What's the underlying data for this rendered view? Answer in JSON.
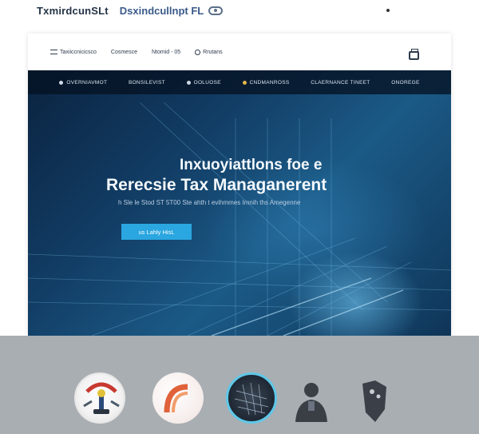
{
  "topbar": {
    "brand_primary": "TxmirdcunSLt",
    "brand_secondary": "Dsxindcullnpt FL"
  },
  "subnav": {
    "items": [
      "Taxiiccnicicsco",
      "Cosmesce",
      "Ntomid - 05",
      "Rrutans"
    ]
  },
  "hero": {
    "nav": [
      "OVERNIAVMOT",
      "BONSILEVIST",
      "OOLUOSE",
      "CNDMANROSS",
      "CLAERNANCE TINEET",
      "ONOREGE"
    ],
    "headline_line1": "Inxuoyiattlons foe e",
    "headline_line2": "Rerecsie Tax Managanerent",
    "subtitle": "h Sle le Stod ST 5T00 Ste ahth t evihmmes Imnih ths Amegenne",
    "cta_label": "us Lahly HisL"
  },
  "colors": {
    "accent": "#2aa6e0",
    "hero_dark": "#0b2340",
    "band": "#a9aeb3"
  },
  "icons": [
    "menu-icon",
    "info-icon",
    "printer-icon",
    "dot-icon",
    "brand-icon"
  ]
}
